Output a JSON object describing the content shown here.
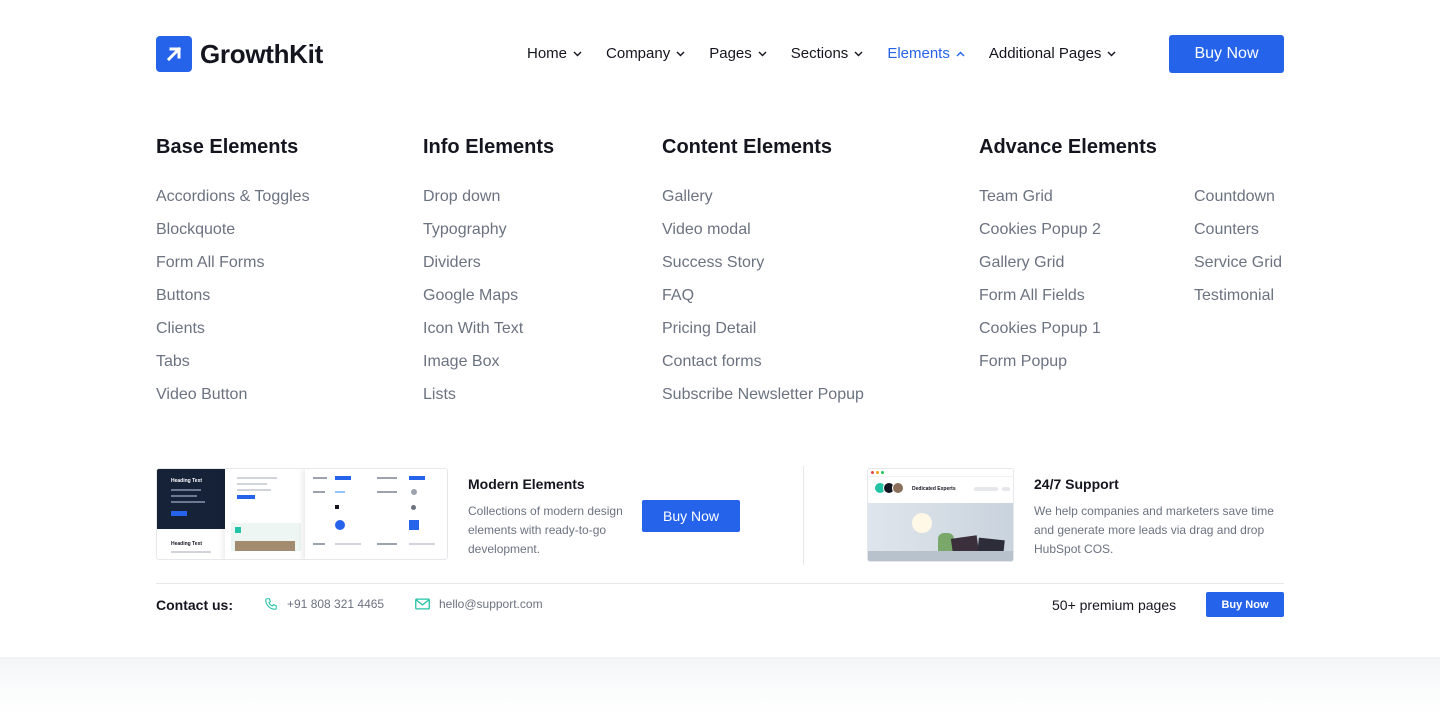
{
  "brand": {
    "name": "GrowthKit",
    "color": "#2563eb",
    "logo_icon": "arrow-up-right-icon"
  },
  "nav": {
    "items": [
      {
        "label": "Home",
        "active": false
      },
      {
        "label": "Company",
        "active": false
      },
      {
        "label": "Pages",
        "active": false
      },
      {
        "label": "Sections",
        "active": false
      },
      {
        "label": "Elements",
        "active": true
      },
      {
        "label": "Additional Pages",
        "active": false
      }
    ],
    "buy_label": "Buy Now"
  },
  "mega_menu": {
    "base": {
      "title": "Base Elements",
      "items": [
        "Accordions & Toggles",
        "Blockquote",
        "Form All Forms",
        "Buttons",
        "Clients",
        "Tabs",
        "Video Button"
      ]
    },
    "info": {
      "title": "Info Elements",
      "items": [
        "Drop down",
        "Typography",
        "Dividers",
        "Google Maps",
        "Icon With Text",
        "Image Box",
        "Lists"
      ]
    },
    "content": {
      "title": "Content Elements",
      "items": [
        "Gallery",
        "Video modal",
        "Success Story",
        "FAQ",
        "Pricing Detail",
        "Contact forms",
        "Subscribe Newsletter Popup"
      ]
    },
    "advance": {
      "title": "Advance Elements",
      "items_a": [
        "Team Grid",
        "Cookies Popup 2",
        "Gallery Grid",
        "Form All Fields",
        "Cookies Popup 1",
        "Form Popup"
      ],
      "items_b": [
        "Countdown",
        "Counters",
        "Service Grid",
        "Testimonial"
      ]
    }
  },
  "promo": {
    "preview": {
      "heading": "Heading Text",
      "heading2": "Heading Text"
    },
    "title": "Modern Elements",
    "text": "Collections of modern design elements with ready-to-go development.",
    "button": "Buy Now"
  },
  "support": {
    "preview_label": "Dedicated Experts",
    "title": "24/7 Support",
    "text": "We help companies and marketers save time and generate more leads via drag and drop HubSpot COS."
  },
  "footer": {
    "contact_label": "Contact us:",
    "phone": "+91 808 321 4465",
    "email": "hello@support.com",
    "premium": "50+ premium pages",
    "button": "Buy Now",
    "icon_color": "#22c3a6"
  }
}
